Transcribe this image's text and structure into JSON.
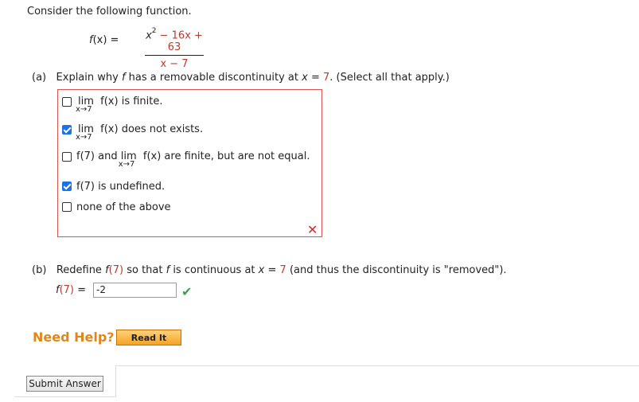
{
  "prompt": "Consider the following function.",
  "function": {
    "label_f": "f",
    "label_rest": "(x) =",
    "numerator_x": "x",
    "numerator_exp": "2",
    "numerator_rest": " − 16x + 63",
    "denominator": "x − 7"
  },
  "part_a": {
    "label": "(a)",
    "text_before": "Explain why ",
    "f": "f",
    "text_mid": " has a removable discontinuity at ",
    "x": "x",
    "eq": " = ",
    "value": "7",
    "text_after": ". (Select all that apply.)",
    "options": [
      {
        "lim": "lim",
        "sub": "x→7",
        "text": "f(x) is finite.",
        "checked": false
      },
      {
        "lim": "lim",
        "sub": "x→7",
        "text": "f(x) does not exists.",
        "checked": true
      },
      {
        "pre": "f(7) and ",
        "lim": "lim",
        "sub": "x→7",
        "text": "f(x) are finite, but are not equal.",
        "checked": false
      },
      {
        "text": "f(7) is undefined.",
        "checked": true
      },
      {
        "text": "none of the above",
        "checked": false
      }
    ],
    "result_icon": "✕"
  },
  "part_b": {
    "label": "(b)",
    "text_before": "Redefine ",
    "f7_f": "f",
    "f7_paren": "(7)",
    "text_mid": " so that ",
    "f": "f",
    "text_mid2": " is continuous at ",
    "x": "x",
    "eq": " = ",
    "value": "7",
    "text_after": " (and thus the discontinuity is \"removed\").",
    "answer_label_f": "f",
    "answer_label_paren": "(7)",
    "answer_label_eq": " =",
    "answer_value": "-2",
    "result_icon": "✔"
  },
  "help": {
    "label": "Need Help?",
    "read_it": "Read It"
  },
  "submit_label": "Submit Answer"
}
